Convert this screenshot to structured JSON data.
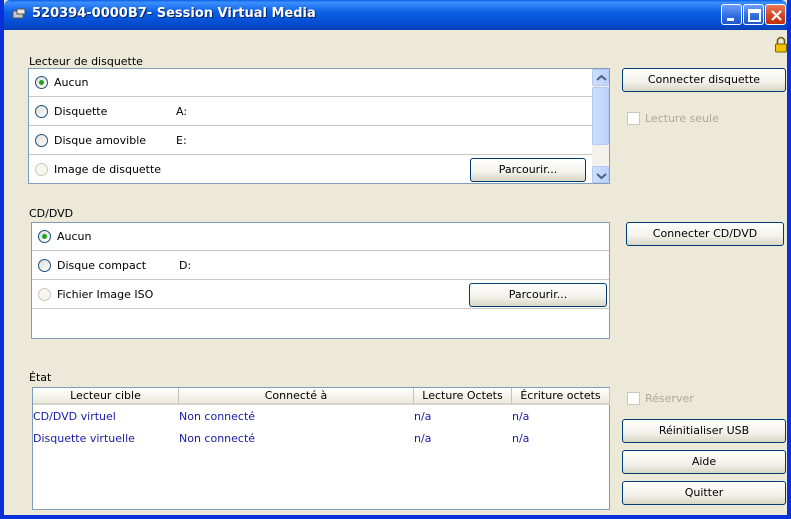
{
  "window": {
    "title": "520394-0000B7- Session Virtual Media"
  },
  "floppy": {
    "group_label": "Lecteur de disquette",
    "options": [
      {
        "label": "Aucun",
        "drive": "",
        "selected": true
      },
      {
        "label": "Disquette",
        "drive": "A:",
        "selected": false
      },
      {
        "label": "Disque amovible",
        "drive": "E:",
        "selected": false
      },
      {
        "label": "Image de disquette",
        "drive": "",
        "selected": false
      }
    ],
    "browse_label": "Parcourir...",
    "connect_label": "Connecter disquette",
    "readonly_label": "Lecture seule"
  },
  "cd": {
    "group_label": "CD/DVD",
    "options": [
      {
        "label": "Aucun",
        "drive": "",
        "selected": true
      },
      {
        "label": "Disque compact",
        "drive": "D:",
        "selected": false
      },
      {
        "label": "Fichier Image ISO",
        "drive": "",
        "selected": false
      }
    ],
    "browse_label": "Parcourir...",
    "connect_label": "Connecter CD/DVD"
  },
  "status": {
    "group_label": "État",
    "columns": [
      "Lecteur cible",
      "Connecté à",
      "Lecture Octets",
      "Écriture octets"
    ],
    "rows": [
      [
        "CD/DVD virtuel",
        "Non connecté",
        "n/a",
        "n/a"
      ],
      [
        "Disquette virtuelle",
        "Non connecté",
        "n/a",
        "n/a"
      ]
    ],
    "reserve_label": "Réserver",
    "reset_usb_label": "Réinitialiser USB",
    "help_label": "Aide",
    "quit_label": "Quitter"
  },
  "colors": {
    "titlebar": "#0548cc",
    "window_bg": "#ece9d8",
    "table_text": "#1a1aa8"
  }
}
